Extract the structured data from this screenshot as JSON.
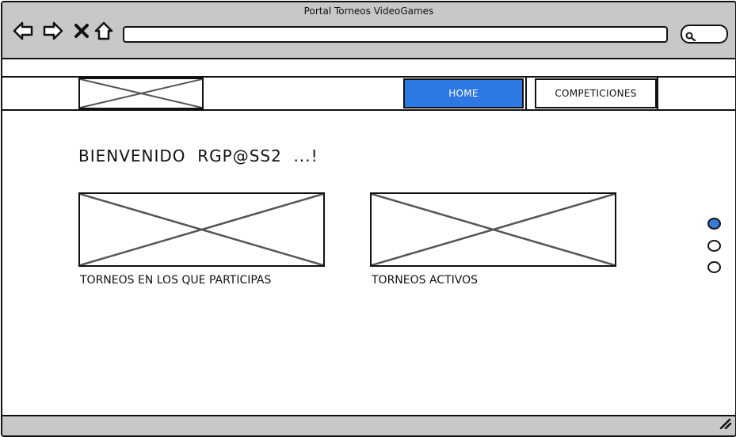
{
  "window": {
    "title": "Portal Torneos VideoGames"
  },
  "toolbar": {
    "back_icon": "back-arrow-icon",
    "forward_icon": "forward-arrow-icon",
    "stop_icon": "close-icon",
    "home_icon": "home-icon",
    "url_value": "",
    "search_value": ""
  },
  "nav": {
    "logo": "image-placeholder",
    "tabs": [
      {
        "label": "HOME",
        "active": true
      },
      {
        "label": "COMPETICIONES",
        "active": false
      }
    ]
  },
  "main": {
    "welcome": "BIENVENIDO  RGP@SS2  ...!",
    "cards": [
      {
        "label": "TORNEOS EN LOS QUE PARTICIPAS",
        "image": "image-placeholder"
      },
      {
        "label": "TORNEOS ACTIVOS",
        "image": "image-placeholder"
      }
    ]
  },
  "pager": {
    "count": 3,
    "active_index": 0
  },
  "colors": {
    "accent": "#2e78e4",
    "chrome": "#c8c8c8",
    "border": "#111111"
  }
}
